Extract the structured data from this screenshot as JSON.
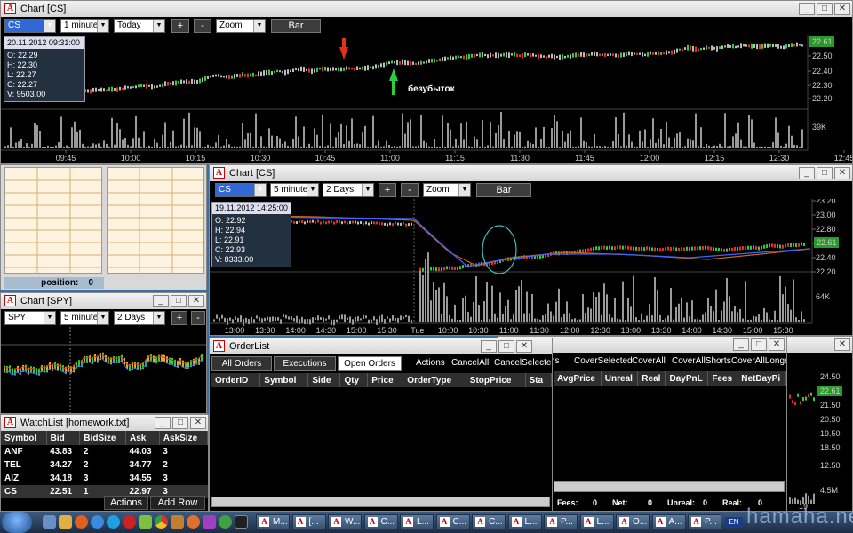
{
  "colors": {
    "bull": "#2ecc40",
    "bear": "#e0321e",
    "volume": "#9a9a9a",
    "grid": "#2a2a2a",
    "last_price_box": "#2a9a2a",
    "circle": "#40c0c0",
    "ma_orange": "#c8641e",
    "ma_blue": "#3c64ff"
  },
  "chart_main": {
    "title": "Chart [CS]",
    "symbol": "CS",
    "interval": "1 minute",
    "range": "Today",
    "plus": "+",
    "minus": "-",
    "zoom": "Zoom",
    "type_btn": "Bar",
    "ohlc": {
      "date": "20.11.2012 09:31:00",
      "o": "O: 22.29",
      "h": "H: 22.30",
      "l": "L: 22.27",
      "c": "C: 22.27",
      "v": "V: 9503.00"
    },
    "last_price": "22.61",
    "price_ticks": [
      "22.50",
      "22.40",
      "22.30",
      "22.20"
    ],
    "volume_tick": "39K",
    "time_ticks": [
      "09:45",
      "10:00",
      "10:15",
      "10:30",
      "10:45",
      "11:00",
      "11:15",
      "11:30",
      "11:45",
      "12:00",
      "12:15",
      "12:30",
      "12:45"
    ],
    "annotation": "безубыток"
  },
  "chart_mid": {
    "title": "Chart [CS]",
    "symbol": "CS",
    "interval": "5 minutes",
    "range": "2 Days",
    "plus": "+",
    "minus": "-",
    "zoom": "Zoom",
    "type_btn": "Bar",
    "ohlc": {
      "date": "19.11.2012 14:25:00",
      "o": "O: 22.92",
      "h": "H: 22.94",
      "l": "L: 22.91",
      "c": "C: 22.93",
      "v": "V: 8333.00"
    },
    "last_price": "22.61",
    "price_ticks": [
      "23.20",
      "23.00",
      "22.80",
      "22.60",
      "22.40",
      "22.20"
    ],
    "volume_tick": "64K",
    "time_ticks": [
      "13:00",
      "13:30",
      "14:00",
      "14:30",
      "15:00",
      "15:30",
      "Tue",
      "10:00",
      "10:30",
      "11:00",
      "11:30",
      "12:00",
      "12:30",
      "13:00",
      "13:30",
      "14:00",
      "14:30",
      "15:00",
      "15:30"
    ]
  },
  "position_panel": {
    "label": "position:",
    "value": "0"
  },
  "chart_spy": {
    "title": "Chart [SPY]",
    "symbol": "SPY",
    "interval": "5 minutes",
    "range": "2 Days",
    "plus": "+",
    "minus": "-"
  },
  "watchlist": {
    "title": "WatchList [homework.txt]",
    "columns": [
      "Symbol",
      "Bid",
      "BidSize",
      "Ask",
      "AskSize"
    ],
    "rows": [
      [
        "ANF",
        "43.83",
        "2",
        "44.03",
        "3"
      ],
      [
        "TEL",
        "34.27",
        "2",
        "34.77",
        "2"
      ],
      [
        "AIZ",
        "34.18",
        "3",
        "34.55",
        "3"
      ],
      [
        "CS",
        "22.51",
        "1",
        "22.97",
        "3"
      ]
    ],
    "actions_btn": "Actions",
    "addrow_btn": "Add Row"
  },
  "orderlist": {
    "title": "OrderList",
    "tabs": [
      "All Orders",
      "Executions",
      "Open Orders"
    ],
    "active_tab": "Open Orders",
    "actions": [
      "Actions",
      "CancelAll",
      "CancelSelected"
    ],
    "columns": [
      "OrderID",
      "Symbol",
      "Side",
      "Qty",
      "Price",
      "OrderType",
      "StopPrice",
      "Sta"
    ]
  },
  "positions": {
    "actions": [
      "ns",
      "CoverSelected",
      "CoverAll",
      "CoverAllShorts",
      "CoverAllLongs"
    ],
    "columns": [
      "AvgPrice",
      "Unreal",
      "Real",
      "DayPnL",
      "Fees",
      "NetDayPi"
    ],
    "footer": [
      {
        "label": "Fees:",
        "value": "0"
      },
      {
        "label": "Net:",
        "value": "0"
      },
      {
        "label": "Unreal:",
        "value": "0"
      },
      {
        "label": "Real:",
        "value": "0"
      }
    ]
  },
  "right_chart": {
    "price_ticks": [
      "24.50",
      "22.61",
      "21.50",
      "20.50",
      "19.50",
      "18.50",
      "12.50"
    ],
    "volume_tick": "4.5M",
    "time_tick": "19"
  },
  "taskbar": {
    "tasks": [
      "M...",
      "[...",
      "W...",
      "C...",
      "L...",
      "C...",
      "C...",
      "L...",
      "P...",
      "L...",
      "O...",
      "A...",
      "P..."
    ],
    "lang": "EN",
    "watermark": "hamaha.net"
  }
}
